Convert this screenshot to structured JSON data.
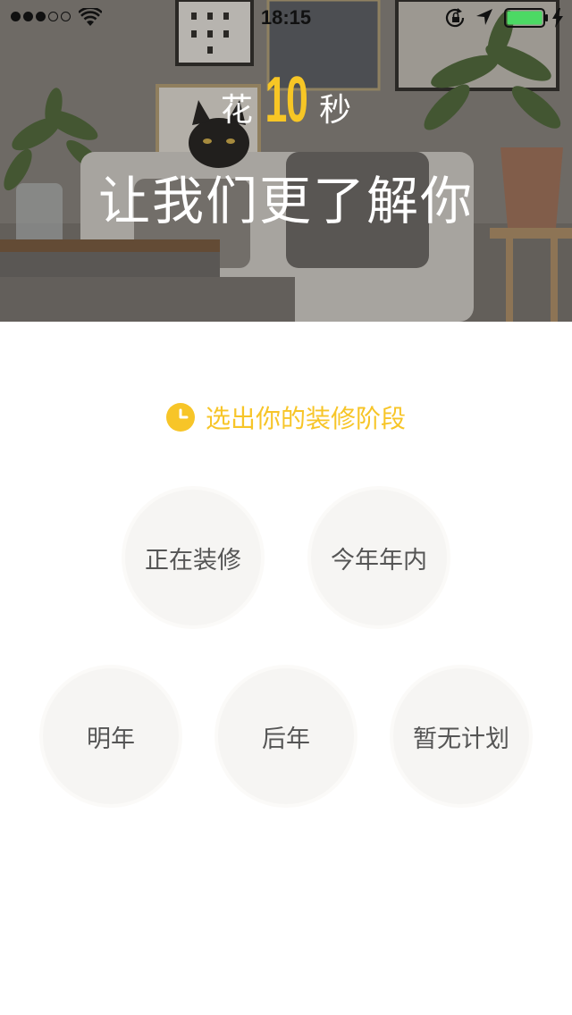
{
  "status_bar": {
    "time": "18:15",
    "signal_dots_filled": 3,
    "signal_dots_total": 5,
    "battery_level": 1.0,
    "icons": [
      "wifi-icon",
      "rotation-lock-icon",
      "location-arrow-icon",
      "battery-icon",
      "charging-bolt-icon"
    ]
  },
  "hero": {
    "prefix": "花",
    "number": "10",
    "suffix": "秒",
    "title": "让我们更了解你"
  },
  "prompt": {
    "label": "选出你的装修阶段",
    "icon": "clock-icon"
  },
  "options": [
    {
      "label": "正在装修"
    },
    {
      "label": "今年年内"
    },
    {
      "label": "明年"
    },
    {
      "label": "后年"
    },
    {
      "label": "暂无计划"
    }
  ],
  "colors": {
    "accent": "#f7c625",
    "option_bg": "#f6f5f3",
    "option_text": "#555555",
    "battery": "#4cd964"
  }
}
